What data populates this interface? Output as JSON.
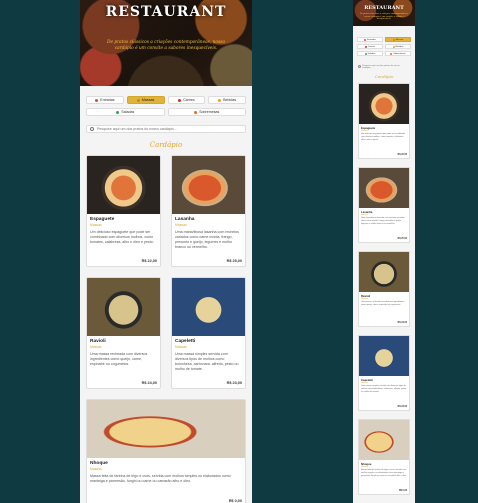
{
  "restaurant": {
    "title": "RESTAURANT",
    "tagline": "De pratos clássicos a criações contemporâneas, nosso cardápio é um convite a sabores inesquecíveis."
  },
  "categories": [
    {
      "label": "Entradas",
      "color": "#e0502a"
    },
    {
      "label": "Massas",
      "color": "#c58a1a",
      "active": true
    },
    {
      "label": "Carnes",
      "color": "#d9302a"
    },
    {
      "label": "Bebidas",
      "color": "#e0a52a"
    },
    {
      "label": "Saladas",
      "color": "#3aa05a"
    },
    {
      "label": "Sobremesas",
      "color": "#e0702a"
    }
  ],
  "search": {
    "placeholder": "Pesquise aqui um dos pratos do nosso cardápio..."
  },
  "menu_title": "Cardápio",
  "dishes": [
    {
      "name": "Espaguete",
      "category": "Massas",
      "description": "Um delicioso espaguete que pode ser combinado com diversos molhos, como tomates, calabresa, alho e óleo e pesto.",
      "price": "R$ 22,00",
      "image": "espaguete"
    },
    {
      "name": "Lasanha",
      "category": "Massas",
      "description": "Uma maravilhosa lasanha com recheios variados como carne moída, frango, presunto e queijo, legumes e molho branco ou vermelho.",
      "price": "R$ 25,00",
      "image": "lasanha"
    },
    {
      "name": "Ravioli",
      "category": "Massas",
      "description": "Uma massa recheada com diversos ingredientes como queijo, carne, espinafre ou cogumelos.",
      "price": "R$ 24,00",
      "image": "ravioli"
    },
    {
      "name": "Capeletti",
      "category": "Massas",
      "description": "Uma massa simples servida com diversos tipos de molhos como bolonhesa, carbonara, alfredo, pesto ou molho de tomate.",
      "price": "R$ 23,00",
      "image": "capeletti"
    },
    {
      "name": "Nhoque",
      "category": "Massas",
      "description": "Massa feita de farinha de trigo e ovos, servida com molhos simples ou elaborados como manteiga e parmesão, funghi ou carne ou camarão alho e óleo.",
      "price": "R$ 0,00",
      "image": "nhoque"
    }
  ]
}
